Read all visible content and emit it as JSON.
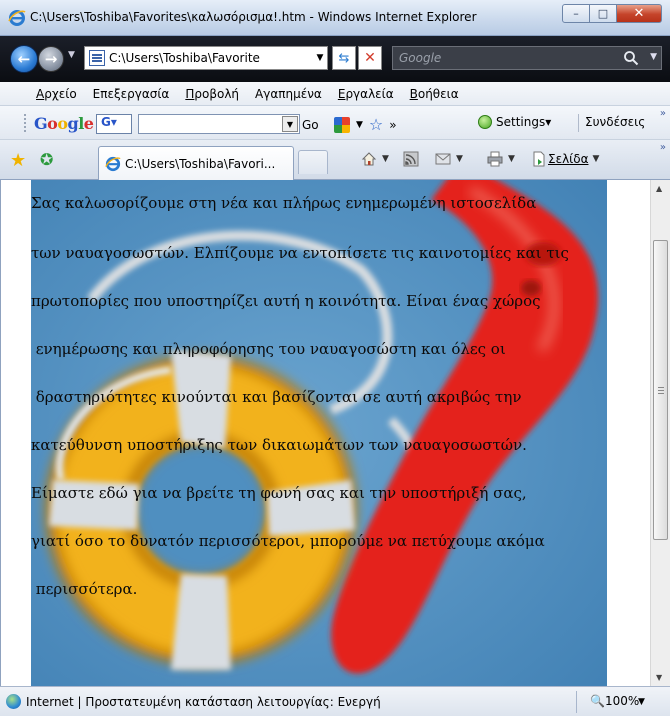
{
  "window": {
    "title": "C:\\Users\\Toshiba\\Favorites\\καλωσόρισμα!.htm - Windows Internet Explorer",
    "minimize_glyph": "–",
    "maximize_glyph": "□",
    "close_glyph": "✕"
  },
  "address": {
    "url": "C:\\Users\\Toshiba\\Favorite",
    "search_placeholder": "Google"
  },
  "menu": [
    {
      "u": "Α",
      "rest": "ρχείο"
    },
    {
      "u": "",
      "rest": "Επεξεργασία"
    },
    {
      "u": "Π",
      "rest": "ροβολή"
    },
    {
      "u": "",
      "rest": "Αγαπημένα"
    },
    {
      "u": "Ε",
      "rest": "ργαλεία"
    },
    {
      "u": "Β",
      "rest": "οήθεια"
    }
  ],
  "google_toolbar": {
    "logo": [
      "G",
      "o",
      "o",
      "g",
      "l",
      "e"
    ],
    "select_label": "G▾",
    "go_label": "Go",
    "settings_label": "Settings▾",
    "links_label": "Συνδέσεις",
    "more": "»"
  },
  "tabs": {
    "active_tab_label": "C:\\Users\\Toshiba\\Favori...",
    "page_label": "Σελίδα",
    "more": "»"
  },
  "content": {
    "lines": [
      "Σας καλωσορίζουμε στη νέα και πλήρως ενημερωμένη ιστοσελίδα",
      "των ναυαγοσωστών. Ελπίζουμε να εντοπίσετε τις καινοτομίες και τις",
      "πρωτοπορίες που υποστηρίζει αυτή η κοινότητα. Είναι ένας χώρος",
      " ενημέρωσης και πληροφόρησης του ναυαγοσώστη και όλες οι",
      " δραστηριότητες κινούνται και βασίζονται σε αυτή ακριβώς την",
      "κατεύθυνση υποστήριξης των δικαιωμάτων των ναυαγοσωστών.",
      "Είμαστε εδώ για να βρείτε τη φωνή σας και την υποστήριξή σας,",
      "γιατί όσο το δυνατόν περισσότεροι, μπορούμε να πετύχουμε ακόμα",
      " περισσότερα."
    ],
    "scroll_position": 0.25
  },
  "status": {
    "text": "Internet | Προστατευμένη κατάσταση λειτουργίας: Ενεργή",
    "zoom": "100%"
  },
  "colors": {
    "page_background_art": "#4f8fc0",
    "life_ring_yellow": "#f2b21c",
    "rescue_tube_red": "#e4241c"
  }
}
